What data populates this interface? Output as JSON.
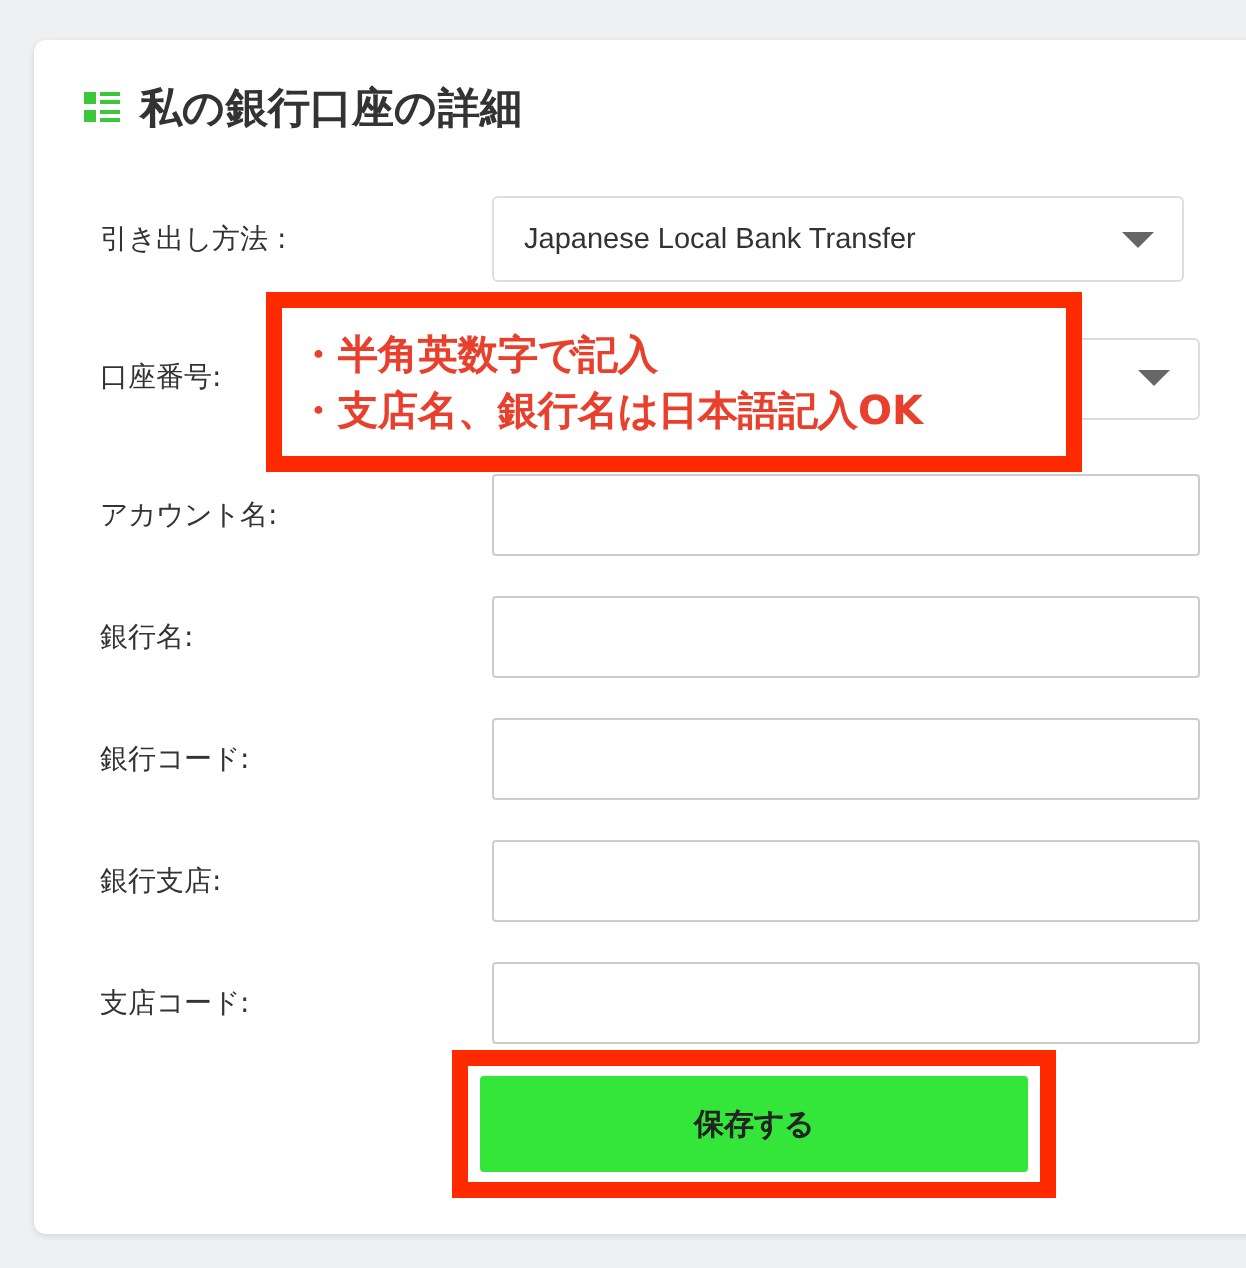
{
  "card": {
    "title": "私の銀行口座の詳細"
  },
  "fields": [
    {
      "label": "引き出し方法 :",
      "kind": "select",
      "value": "Japanese Local Bank Transfer"
    },
    {
      "label": "口座番号:",
      "kind": "select"
    },
    {
      "label": "アカウント名:",
      "kind": "text"
    },
    {
      "label": "銀行名:",
      "kind": "text"
    },
    {
      "label": "銀行コード:",
      "kind": "text"
    },
    {
      "label": "銀行支店:",
      "kind": "text"
    },
    {
      "label": "支店コード:",
      "kind": "text"
    }
  ],
  "annotation": {
    "lines": [
      "・半角英数字で記入",
      "・支店名、銀行名は日本語記入OK"
    ]
  },
  "save_button": {
    "label": "保存する",
    "highlighted": true
  }
}
